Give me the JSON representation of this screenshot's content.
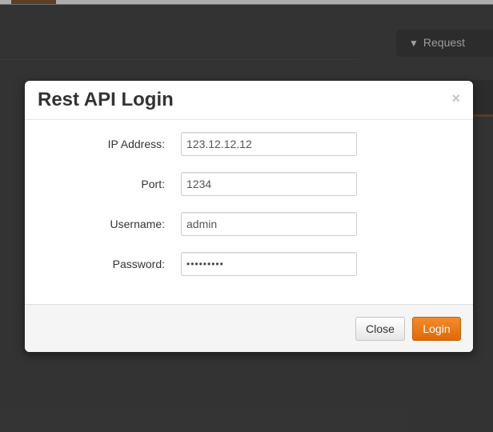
{
  "background": {
    "tab_label": "Request",
    "tab_icon": "caret-down-icon"
  },
  "modal": {
    "title": "Rest API Login",
    "close_symbol": "×",
    "fields": [
      {
        "label": "IP Address:",
        "value": "123.12.12.12"
      },
      {
        "label": "Port:",
        "value": "1234"
      },
      {
        "label": "Username:",
        "value": "admin"
      },
      {
        "label": "Password:",
        "value": "•••••••••"
      }
    ],
    "close_button": "Close",
    "login_button": "Login"
  },
  "colors": {
    "accent": "#e8760f",
    "background": "#3a3a3a"
  }
}
